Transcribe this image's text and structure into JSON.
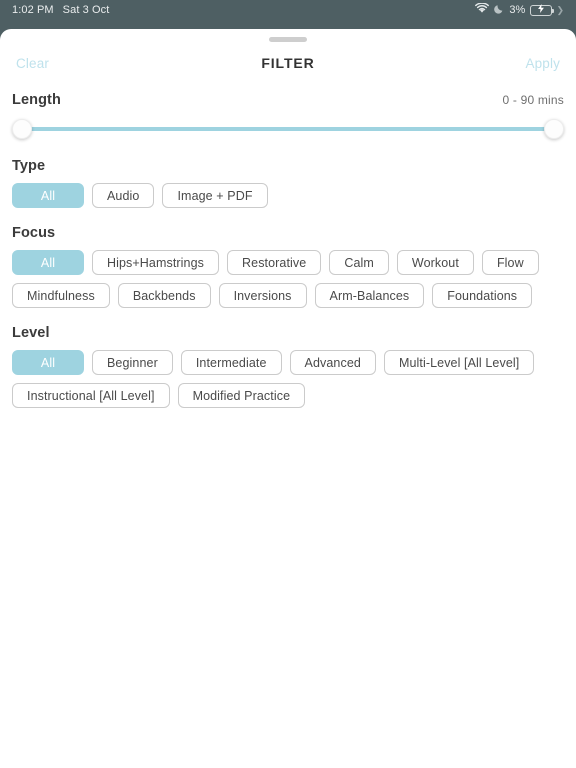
{
  "status_bar": {
    "time": "1:02 PM",
    "date": "Sat 3 Oct",
    "wifi_icon": "wifi-icon",
    "dnd_icon": "crescent-moon-icon",
    "battery_percent": "3%",
    "battery_icon": "battery-charging-icon"
  },
  "backdrop": {
    "obscured_line_a": "",
    "obscured_line_b": ""
  },
  "sheet": {
    "grabber": "drag-handle",
    "header": {
      "clear_label": "Clear",
      "title": "FILTER",
      "apply_label": "Apply"
    },
    "sections": {
      "length": {
        "title": "Length",
        "value_label": "0 - 90 mins",
        "min": 0,
        "max": 90,
        "unit": "mins",
        "low_value": 0,
        "high_value": 90
      },
      "type": {
        "title": "Type",
        "options": [
          {
            "label": "All",
            "selected": true
          },
          {
            "label": "Audio",
            "selected": false
          },
          {
            "label": "Image + PDF",
            "selected": false
          }
        ]
      },
      "focus": {
        "title": "Focus",
        "options": [
          {
            "label": "All",
            "selected": true
          },
          {
            "label": "Hips+Hamstrings",
            "selected": false
          },
          {
            "label": "Restorative",
            "selected": false
          },
          {
            "label": "Calm",
            "selected": false
          },
          {
            "label": "Workout",
            "selected": false
          },
          {
            "label": "Flow",
            "selected": false
          },
          {
            "label": "Mindfulness",
            "selected": false
          },
          {
            "label": "Backbends",
            "selected": false
          },
          {
            "label": "Inversions",
            "selected": false
          },
          {
            "label": "Arm-Balances",
            "selected": false
          },
          {
            "label": "Foundations",
            "selected": false
          }
        ]
      },
      "level": {
        "title": "Level",
        "options": [
          {
            "label": "All",
            "selected": true
          },
          {
            "label": "Beginner",
            "selected": false
          },
          {
            "label": "Intermediate",
            "selected": false
          },
          {
            "label": "Advanced",
            "selected": false
          },
          {
            "label": "Multi-Level [All Level]",
            "selected": false
          },
          {
            "label": "Instructional [All Level]",
            "selected": false
          },
          {
            "label": "Modified Practice",
            "selected": false
          }
        ]
      }
    }
  },
  "colors": {
    "accent": "#9ed3e0",
    "accent_text": "#bfe2ec",
    "backdrop": "#4e5f63",
    "chip_border": "#cbcbcb",
    "battery_low": "#e8534a"
  }
}
